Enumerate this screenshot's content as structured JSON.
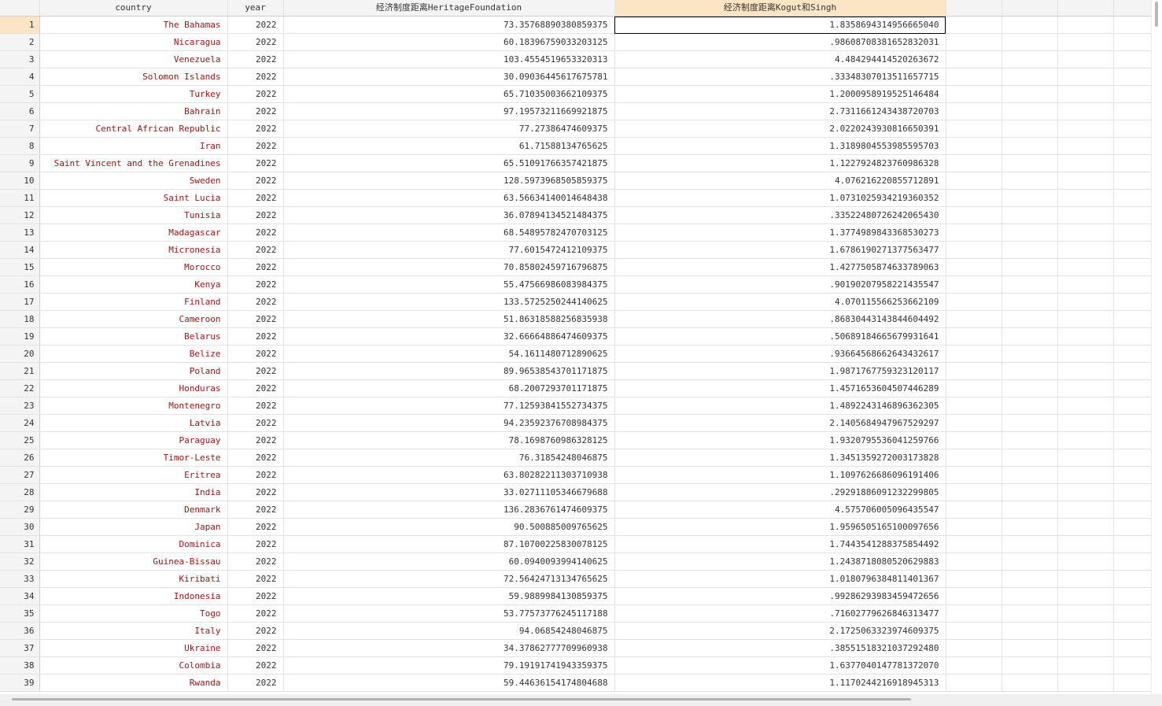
{
  "columns": [
    "",
    "country",
    "year",
    "经济制度距离HeritageFoundation",
    "经济制度距离Kogut和Singh",
    "",
    "",
    "",
    ""
  ],
  "rows": [
    {
      "n": "1",
      "country": "The Bahamas",
      "year": "2022",
      "heritage": "73.35768890380859375",
      "kogut": "1.8358694314956665040"
    },
    {
      "n": "2",
      "country": "Nicaragua",
      "year": "2022",
      "heritage": "60.18396759033203125",
      "kogut": ".98608708381652832031"
    },
    {
      "n": "3",
      "country": "Venezuela",
      "year": "2022",
      "heritage": "103.4554519653320313",
      "kogut": "4.484294414520263672"
    },
    {
      "n": "4",
      "country": "Solomon Islands",
      "year": "2022",
      "heritage": "30.09036445617675781",
      "kogut": ".33348307013511657715"
    },
    {
      "n": "5",
      "country": "Turkey",
      "year": "2022",
      "heritage": "65.71035003662109375",
      "kogut": "1.2000958919525146484"
    },
    {
      "n": "6",
      "country": "Bahrain",
      "year": "2022",
      "heritage": "97.19573211669921875",
      "kogut": "2.7311661243438720703"
    },
    {
      "n": "7",
      "country": "Central African Republic",
      "year": "2022",
      "heritage": "77.27386474609375",
      "kogut": "2.0220243930816650391"
    },
    {
      "n": "8",
      "country": "Iran",
      "year": "2022",
      "heritage": "61.71588134765625",
      "kogut": "1.3189804553985595703"
    },
    {
      "n": "9",
      "country": "Saint Vincent and the Grenadines",
      "year": "2022",
      "heritage": "65.51091766357421875",
      "kogut": "1.1227924823760986328"
    },
    {
      "n": "10",
      "country": "Sweden",
      "year": "2022",
      "heritage": "128.5973968505859375",
      "kogut": "4.076216220855712891"
    },
    {
      "n": "11",
      "country": "Saint Lucia",
      "year": "2022",
      "heritage": "63.56634140014648438",
      "kogut": "1.0731025934219360352"
    },
    {
      "n": "12",
      "country": "Tunisia",
      "year": "2022",
      "heritage": "36.07894134521484375",
      "kogut": ".33522480726242065430"
    },
    {
      "n": "13",
      "country": "Madagascar",
      "year": "2022",
      "heritage": "68.54895782470703125",
      "kogut": "1.3774989843368530273"
    },
    {
      "n": "14",
      "country": "Micronesia",
      "year": "2022",
      "heritage": "77.6015472412109375",
      "kogut": "1.6786190271377563477"
    },
    {
      "n": "15",
      "country": "Morocco",
      "year": "2022",
      "heritage": "70.85802459716796875",
      "kogut": "1.4277505874633789063"
    },
    {
      "n": "16",
      "country": "Kenya",
      "year": "2022",
      "heritage": "55.47566986083984375",
      "kogut": ".90190207958221435547"
    },
    {
      "n": "17",
      "country": "Finland",
      "year": "2022",
      "heritage": "133.5725250244140625",
      "kogut": "4.070115566253662109"
    },
    {
      "n": "18",
      "country": "Cameroon",
      "year": "2022",
      "heritage": "51.86318588256835938",
      "kogut": ".86830443143844604492"
    },
    {
      "n": "19",
      "country": "Belarus",
      "year": "2022",
      "heritage": "32.66664886474609375",
      "kogut": ".50689184665679931641"
    },
    {
      "n": "20",
      "country": "Belize",
      "year": "2022",
      "heritage": "54.1611480712890625",
      "kogut": ".93664568662643432617"
    },
    {
      "n": "21",
      "country": "Poland",
      "year": "2022",
      "heritage": "89.96538543701171875",
      "kogut": "1.9871767759323120117"
    },
    {
      "n": "22",
      "country": "Honduras",
      "year": "2022",
      "heritage": "68.2007293701171875",
      "kogut": "1.4571653604507446289"
    },
    {
      "n": "23",
      "country": "Montenegro",
      "year": "2022",
      "heritage": "77.12593841552734375",
      "kogut": "1.4892243146896362305"
    },
    {
      "n": "24",
      "country": "Latvia",
      "year": "2022",
      "heritage": "94.23592376708984375",
      "kogut": "2.1405684947967529297"
    },
    {
      "n": "25",
      "country": "Paraguay",
      "year": "2022",
      "heritage": "78.1698760986328125",
      "kogut": "1.9320795536041259766"
    },
    {
      "n": "26",
      "country": "Timor-Leste",
      "year": "2022",
      "heritage": "76.31854248046875",
      "kogut": "1.3451359272003173828"
    },
    {
      "n": "27",
      "country": "Eritrea",
      "year": "2022",
      "heritage": "63.80282211303710938",
      "kogut": "1.1097626686096191406"
    },
    {
      "n": "28",
      "country": "India",
      "year": "2022",
      "heritage": "33.02711105346679688",
      "kogut": ".29291886091232299805"
    },
    {
      "n": "29",
      "country": "Denmark",
      "year": "2022",
      "heritage": "136.2836761474609375",
      "kogut": "4.575706005096435547"
    },
    {
      "n": "30",
      "country": "Japan",
      "year": "2022",
      "heritage": "90.500885009765625",
      "kogut": "1.9596505165100097656"
    },
    {
      "n": "31",
      "country": "Dominica",
      "year": "2022",
      "heritage": "87.10700225830078125",
      "kogut": "1.7443541288375854492"
    },
    {
      "n": "32",
      "country": "Guinea-Bissau",
      "year": "2022",
      "heritage": "60.0940093994140625",
      "kogut": "1.2438718080520629883"
    },
    {
      "n": "33",
      "country": "Kiribati",
      "year": "2022",
      "heritage": "72.56424713134765625",
      "kogut": "1.0180796384811401367"
    },
    {
      "n": "34",
      "country": "Indonesia",
      "year": "2022",
      "heritage": "59.9889984130859375",
      "kogut": ".99286293983459472656"
    },
    {
      "n": "35",
      "country": "Togo",
      "year": "2022",
      "heritage": "53.77573776245117188",
      "kogut": ".71602779626846313477"
    },
    {
      "n": "36",
      "country": "Italy",
      "year": "2022",
      "heritage": "94.06854248046875",
      "kogut": "2.1725063323974609375"
    },
    {
      "n": "37",
      "country": "Ukraine",
      "year": "2022",
      "heritage": "34.37862777709960938",
      "kogut": ".38551518321037292480"
    },
    {
      "n": "38",
      "country": "Colombia",
      "year": "2022",
      "heritage": "79.19191741943359375",
      "kogut": "1.6377040147781372070"
    },
    {
      "n": "39",
      "country": "Rwanda",
      "year": "2022",
      "heritage": "59.44636154174804688",
      "kogut": "1.1170244216918945313"
    }
  ]
}
